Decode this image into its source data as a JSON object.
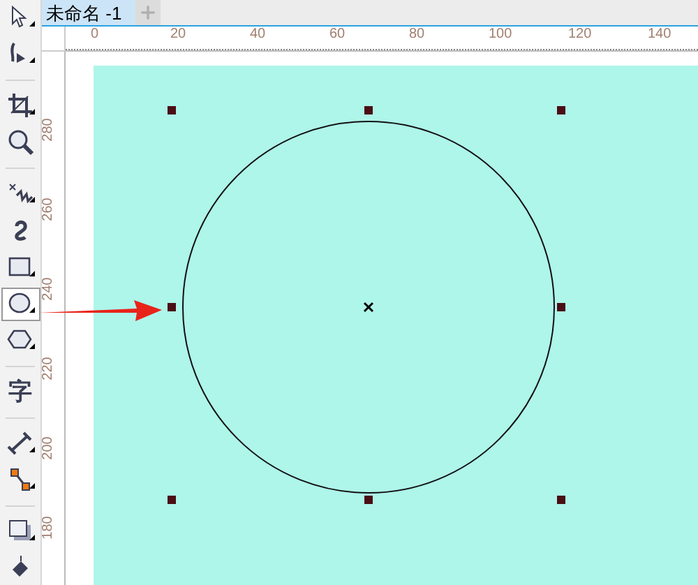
{
  "tabs": [
    {
      "label": "未命名 -1",
      "selected": true
    }
  ],
  "tools": [
    {
      "kind": "pick",
      "selected": false
    },
    {
      "kind": "shape",
      "selected": false
    },
    {
      "kind": "divider"
    },
    {
      "kind": "crop",
      "selected": false
    },
    {
      "kind": "zoom",
      "selected": false
    },
    {
      "kind": "divider"
    },
    {
      "kind": "freehand",
      "selected": false
    },
    {
      "kind": "artistic",
      "selected": false
    },
    {
      "kind": "rectangle",
      "selected": false
    },
    {
      "kind": "ellipse",
      "selected": true
    },
    {
      "kind": "polygon",
      "selected": false
    },
    {
      "kind": "divider"
    },
    {
      "kind": "text",
      "label": "字",
      "selected": false
    },
    {
      "kind": "divider"
    },
    {
      "kind": "dimension",
      "selected": false
    },
    {
      "kind": "connector",
      "selected": false
    },
    {
      "kind": "divider"
    },
    {
      "kind": "shadow",
      "selected": false
    },
    {
      "kind": "fill",
      "selected": false
    }
  ],
  "horizontal_ruler": [
    "0",
    "20",
    "40",
    "60",
    "80",
    "100",
    "120",
    "140"
  ],
  "vertical_ruler": [
    "280",
    "260",
    "240",
    "220",
    "200",
    "180"
  ]
}
